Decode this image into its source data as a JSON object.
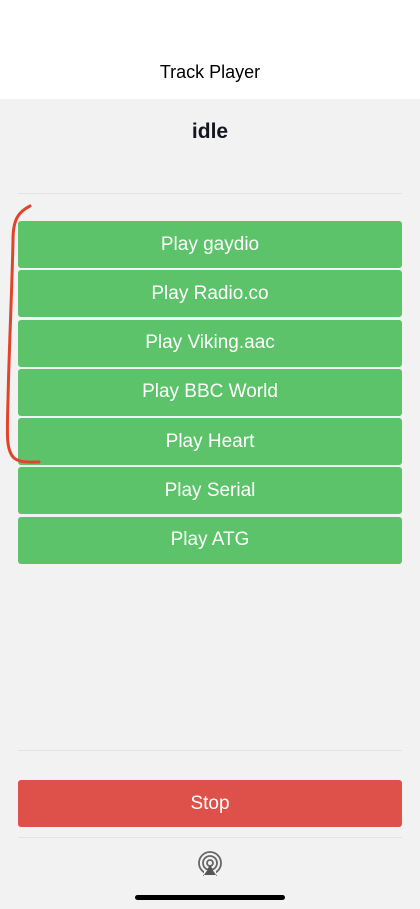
{
  "header": {
    "title": "Track Player"
  },
  "player": {
    "status": "idle"
  },
  "tracks": [
    {
      "label": "Play gaydio"
    },
    {
      "label": "Play Radio.co"
    },
    {
      "label": "Play Viking.aac"
    },
    {
      "label": "Play BBC World"
    },
    {
      "label": "Play Heart"
    },
    {
      "label": "Play Serial"
    },
    {
      "label": "Play ATG"
    }
  ],
  "controls": {
    "stop_label": "Stop",
    "airplay_icon": "airplay-icon"
  },
  "colors": {
    "play_button": "#5cc36a",
    "stop_button": "#dd514a",
    "annotation": "#e0442c"
  }
}
